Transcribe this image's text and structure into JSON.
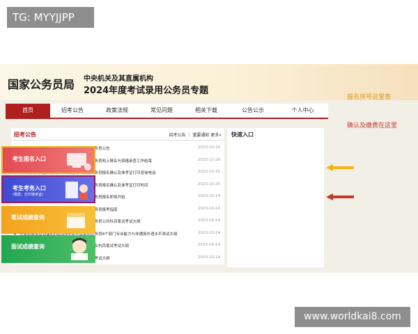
{
  "watermark_tag": "TG: MYYJJPP",
  "header": {
    "logo": "国家公务员局",
    "subtitle1": "中央机关及其直属机构",
    "subtitle2": "2024年度考试录用公务员专题"
  },
  "nav": [
    "首页",
    "招考公告",
    "政策法规",
    "常见问题",
    "相关下载",
    "公告公示",
    "个人中心"
  ],
  "panel": {
    "title": "招考公告",
    "links": "招考公告 ｜ 重要通知   更多»",
    "rows": [
      {
        "title": "中央机关及其直属机构2024年度考试录用公务员公告",
        "date": "2023-10-14"
      },
      {
        "title": "中央机关及其直属机构2024年度考试录用公务员网上报名与资格审查工作结束",
        "date": "2023-10-26"
      },
      {
        "title": "中央机关及其直属机构2024年度考试录用公务员报名确认及准考证打印咨询电话",
        "date": "2023-10-31"
      },
      {
        "title": "中央机关及其直属机构2024年度考试录用公务员报名确认及准考证打印时间",
        "date": "2023-10-25"
      },
      {
        "title": "中央机关及其直属机构2024年度考试录用公务员报名即将开始",
        "date": "2023-10-14"
      },
      {
        "title": "中央机关及其直属机构2024年度考试录用公务员报考指南",
        "date": "2023-10-14"
      },
      {
        "title": "中央机关及其直属机构2024年度考试录用公务员公共科目笔试考试大纲",
        "date": "2023-10-14"
      },
      {
        "title": "中央机关及其直属机构2024年度考试录用公务员8个部门专业能力与非通用外语水平测试大纲",
        "date": "2023-10-14"
      },
      {
        "title": "2024年度国家金融监督管理总局招考职位专业科目笔试考试大纲",
        "date": "2023-10-14"
      },
      {
        "title": "2024年度中国证监会招考职位专业科目笔试考试大纲",
        "date": "2023-10-14"
      }
    ]
  },
  "quick": {
    "title": "快速入口",
    "buttons": [
      {
        "label": "考生报名入口",
        "sub": ""
      },
      {
        "label": "考生考务入口",
        "sub": "(缴费、打印准考证)"
      },
      {
        "label": "笔试成绩查询",
        "sub": ""
      },
      {
        "label": "面试成绩查询",
        "sub": ""
      }
    ]
  },
  "annotations": [
    "报名序号这里查",
    "确认及缴费在这里"
  ],
  "watermark_url": "www.worldkai8.com"
}
